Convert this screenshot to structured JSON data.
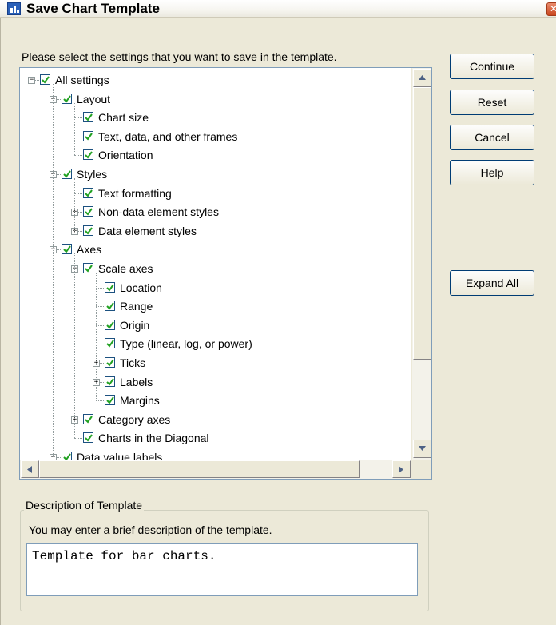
{
  "window": {
    "title": "Save Chart Template",
    "close_glyph": "✕"
  },
  "prompt": "Please select the settings that you want to save in the template.",
  "tree": [
    {
      "label": "All settings",
      "level": 0,
      "expander": "−",
      "checked": true
    },
    {
      "label": "Layout",
      "level": 1,
      "expander": "−",
      "checked": true
    },
    {
      "label": "Chart size",
      "level": 2,
      "expander": null,
      "checked": true
    },
    {
      "label": "Text, data, and other frames",
      "level": 2,
      "expander": null,
      "checked": true
    },
    {
      "label": "Orientation",
      "level": 2,
      "expander": null,
      "checked": true
    },
    {
      "label": "Styles",
      "level": 1,
      "expander": "−",
      "checked": true
    },
    {
      "label": "Text formatting",
      "level": 2,
      "expander": null,
      "checked": true
    },
    {
      "label": "Non-data element styles",
      "level": 2,
      "expander": "+",
      "checked": true
    },
    {
      "label": "Data element styles",
      "level": 2,
      "expander": "+",
      "checked": true
    },
    {
      "label": "Axes",
      "level": 1,
      "expander": "−",
      "checked": true
    },
    {
      "label": "Scale axes",
      "level": 2,
      "expander": "−",
      "checked": true
    },
    {
      "label": "Location",
      "level": 3,
      "expander": null,
      "checked": true
    },
    {
      "label": "Range",
      "level": 3,
      "expander": null,
      "checked": true
    },
    {
      "label": "Origin",
      "level": 3,
      "expander": null,
      "checked": true
    },
    {
      "label": "Type (linear, log, or power)",
      "level": 3,
      "expander": null,
      "checked": true
    },
    {
      "label": "Ticks",
      "level": 3,
      "expander": "+",
      "checked": true
    },
    {
      "label": "Labels",
      "level": 3,
      "expander": "+",
      "checked": true
    },
    {
      "label": "Margins",
      "level": 3,
      "expander": null,
      "checked": true
    },
    {
      "label": "Category axes",
      "level": 2,
      "expander": "+",
      "checked": true
    },
    {
      "label": "Charts in the Diagonal",
      "level": 2,
      "expander": null,
      "checked": true
    },
    {
      "label": "Data value labels",
      "level": 1,
      "expander": "−",
      "checked": true
    }
  ],
  "buttons": {
    "continue": "Continue",
    "reset": "Reset",
    "cancel": "Cancel",
    "help": "Help",
    "expand_all": "Expand All"
  },
  "description": {
    "group_title": "Description of Template",
    "hint": "You may enter a brief description of the template.",
    "value": "Template for bar charts."
  }
}
